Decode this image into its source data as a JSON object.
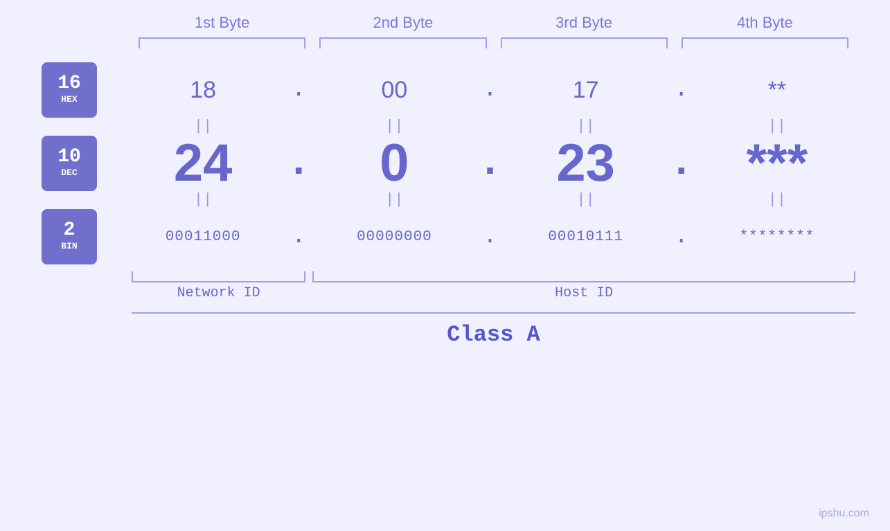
{
  "page": {
    "background": "#f0f0ff",
    "watermark": "ipshu.com"
  },
  "headers": {
    "byte1": "1st Byte",
    "byte2": "2nd Byte",
    "byte3": "3rd Byte",
    "byte4": "4th Byte"
  },
  "badges": {
    "hex": {
      "number": "16",
      "label": "HEX"
    },
    "dec": {
      "number": "10",
      "label": "DEC"
    },
    "bin": {
      "number": "2",
      "label": "BIN"
    }
  },
  "hex_row": {
    "b1": "18",
    "b2": "00",
    "b3": "17",
    "b4": "**",
    "dot": "."
  },
  "dec_row": {
    "b1": "24",
    "b2": "0",
    "b3": "23",
    "b4": "***",
    "dot": "."
  },
  "bin_row": {
    "b1": "00011000",
    "b2": "00000000",
    "b3": "00010111",
    "b4": "********",
    "dot": "."
  },
  "equals": "||",
  "network_id_label": "Network ID",
  "host_id_label": "Host ID",
  "class_label": "Class A"
}
